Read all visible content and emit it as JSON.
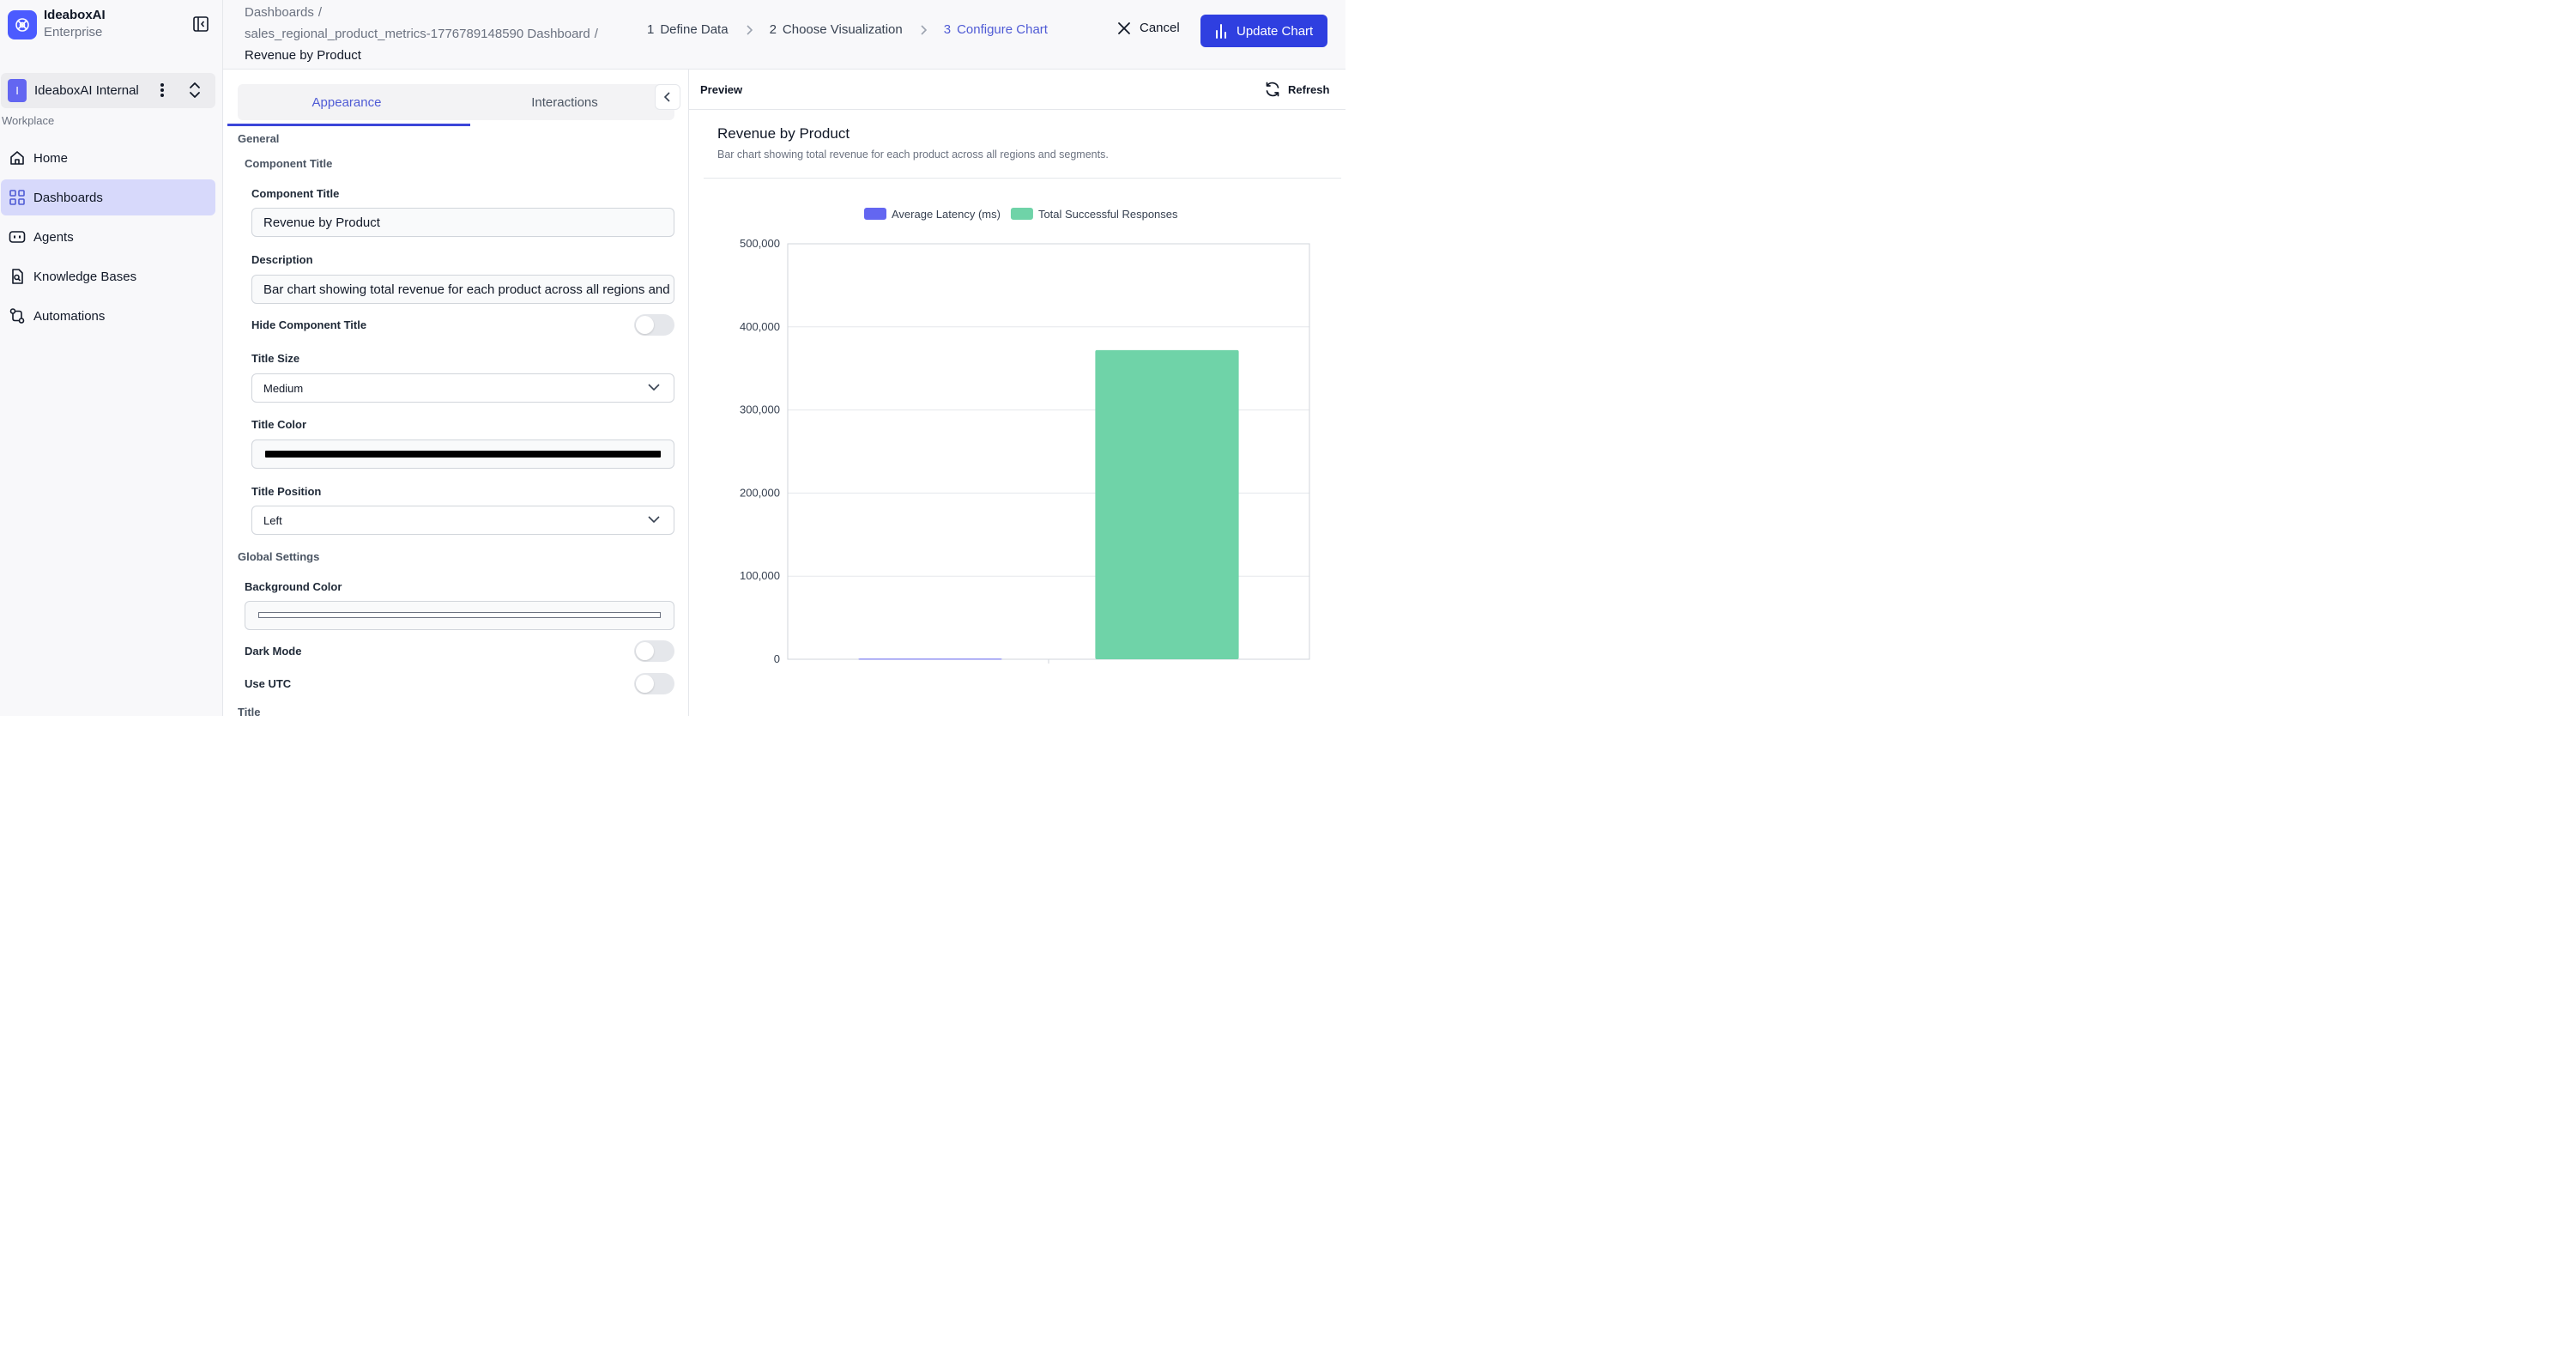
{
  "sidebar": {
    "brand_name": "IdeaboxAI",
    "brand_sub": "Enterprise",
    "org_initial": "I",
    "org_name": "IdeaboxAI Internal",
    "section_label": "Workplace",
    "items": [
      {
        "label": "Home",
        "icon": "home-icon"
      },
      {
        "label": "Dashboards",
        "icon": "grid-icon",
        "active": true
      },
      {
        "label": "Agents",
        "icon": "bot-icon"
      },
      {
        "label": "Knowledge Bases",
        "icon": "document-search-icon"
      },
      {
        "label": "Automations",
        "icon": "workflow-icon"
      }
    ]
  },
  "header": {
    "crumb_1": "Dashboards",
    "crumb_2": "sales_regional_product_metrics-1776789148590 Dashboard",
    "crumb_current": "Revenue by Product",
    "separator": "/",
    "steps": [
      {
        "num": "1",
        "label": "Define Data"
      },
      {
        "num": "2",
        "label": "Choose Visualization"
      },
      {
        "num": "3",
        "label": "Configure Chart",
        "active": true
      }
    ],
    "cancel_label": "Cancel",
    "update_label": "Update Chart"
  },
  "config": {
    "tabs": [
      "Appearance",
      "Interactions"
    ],
    "active_tab": "Appearance",
    "general_title": "General",
    "component_title_section": "Component Title",
    "component_title_label": "Component Title",
    "component_title_value": "Revenue by Product",
    "description_label": "Description",
    "description_value": "Bar chart showing total revenue for each product across all regions and segments.",
    "hide_title_label": "Hide Component Title",
    "hide_title_on": false,
    "title_size_label": "Title Size",
    "title_size_value": "Medium",
    "title_color_label": "Title Color",
    "title_color_value": "#000000",
    "title_position_label": "Title Position",
    "title_position_value": "Left",
    "global_title": "Global Settings",
    "bg_color_label": "Background Color",
    "bg_color_value": "#ffffff",
    "dark_mode_label": "Dark Mode",
    "dark_mode_on": false,
    "use_utc_label": "Use UTC",
    "use_utc_on": false,
    "title_section": "Title"
  },
  "preview": {
    "label": "Preview",
    "refresh_label": "Refresh",
    "chart_title": "Revenue by Product",
    "chart_description": "Bar chart showing total revenue for each product across all regions and segments."
  },
  "chart_data": {
    "type": "bar",
    "title": "Revenue by Product",
    "subtitle": "Bar chart showing total revenue for each product across all regions and segments.",
    "categories": [
      ""
    ],
    "series": [
      {
        "name": "Average Latency (ms)",
        "values": [
          600
        ],
        "color": "#6366f1"
      },
      {
        "name": "Total Successful Responses",
        "values": [
          372000
        ],
        "color": "#6fd3a8"
      }
    ],
    "ylim": [
      0,
      500000
    ],
    "yticks": [
      0,
      100000,
      200000,
      300000,
      400000,
      500000
    ],
    "ytick_labels": [
      "0",
      "100,000",
      "200,000",
      "300,000",
      "400,000",
      "500,000"
    ],
    "grid": true,
    "legend": "top-center"
  },
  "colors": {
    "accent": "#2f3fe0",
    "active_nav": "#d7d9fb",
    "active_step": "#4f5bd5"
  }
}
